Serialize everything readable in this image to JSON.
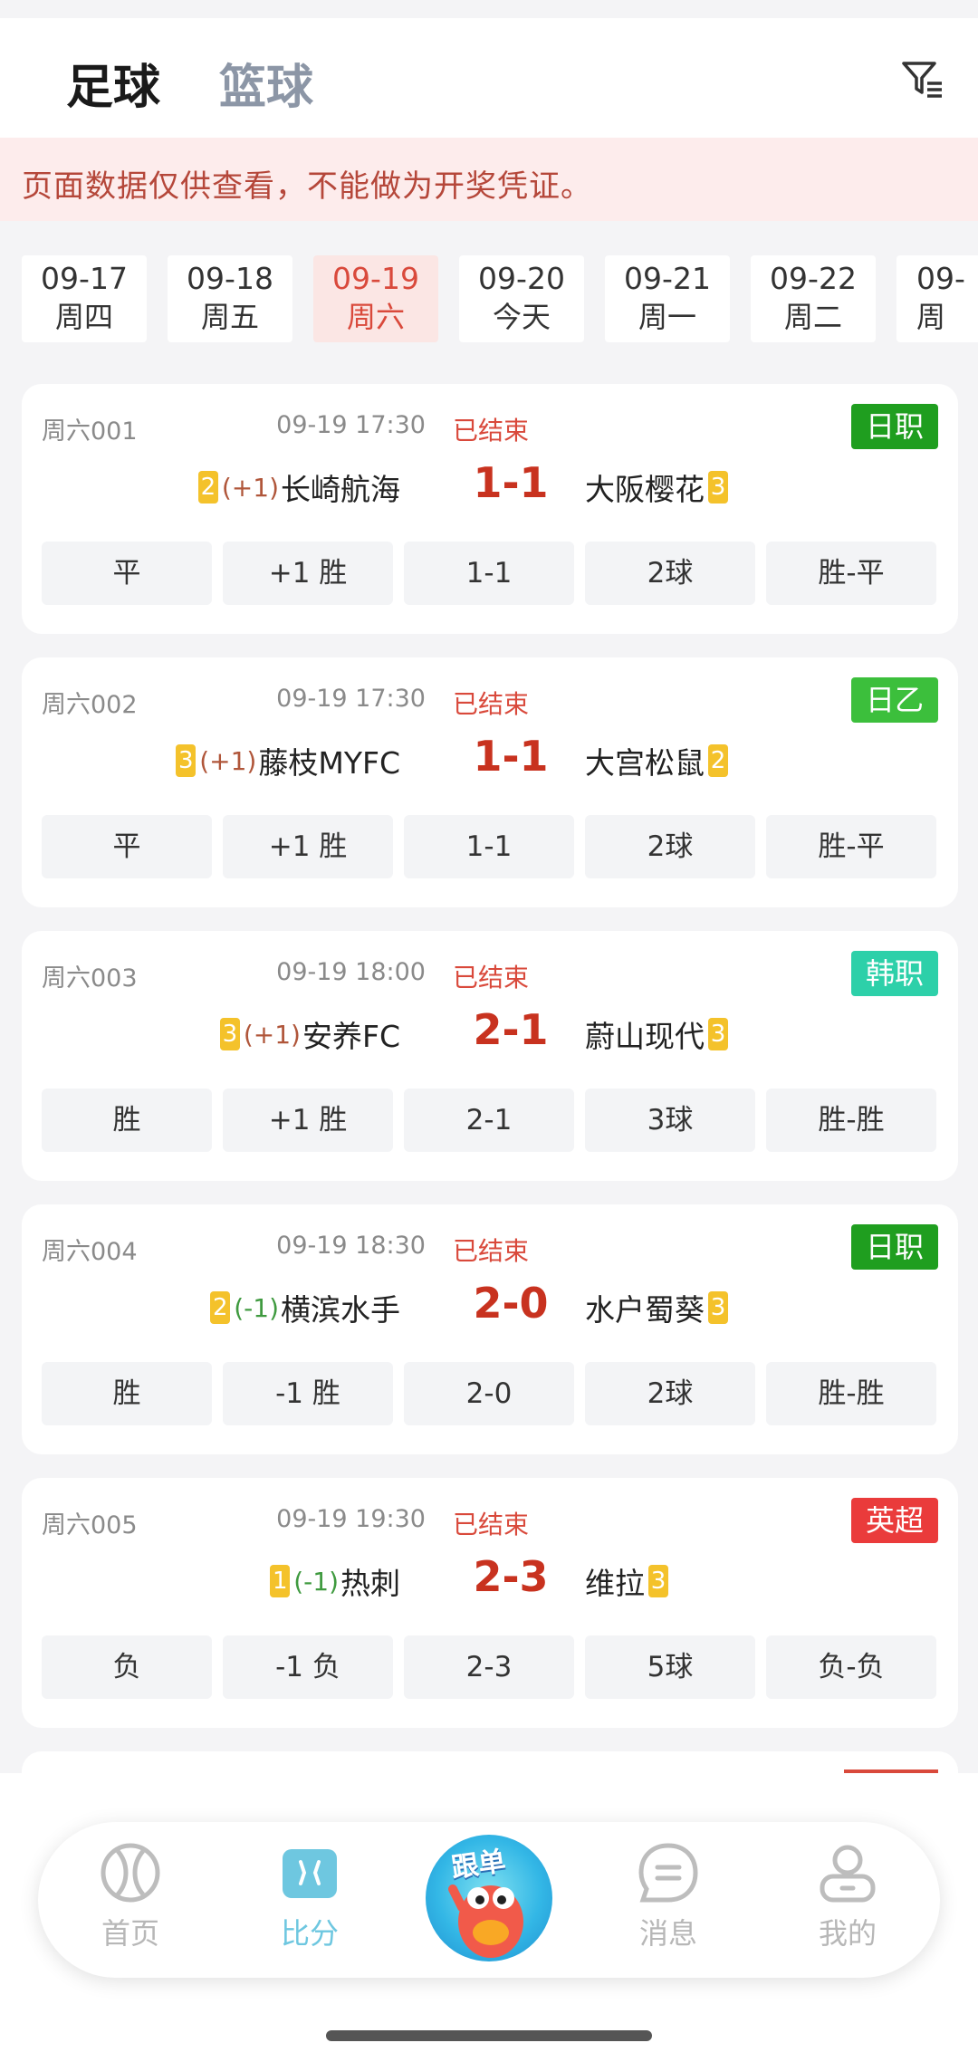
{
  "header": {
    "tab_football": "足球",
    "tab_basketball": "篮球",
    "filter_icon": "filter-icon"
  },
  "notice": "页面数据仅供查看，不能做为开奖凭证。",
  "dates": [
    {
      "date": "09-17",
      "weekday": "周四",
      "active": false
    },
    {
      "date": "09-18",
      "weekday": "周五",
      "active": false
    },
    {
      "date": "09-19",
      "weekday": "周六",
      "active": true
    },
    {
      "date": "09-20",
      "weekday": "今天",
      "active": false
    },
    {
      "date": "09-21",
      "weekday": "周一",
      "active": false
    },
    {
      "date": "09-22",
      "weekday": "周二",
      "active": false
    },
    {
      "date": "09-",
      "weekday": "周",
      "active": false
    }
  ],
  "matches": [
    {
      "code": "周六001",
      "time": "09-19 17:30",
      "status": "已结束",
      "league": "日职",
      "league_color": "#1f9e1f",
      "home_rank": "2",
      "handicap": "(+1)",
      "home": "长崎航海",
      "score": "1-1",
      "away": "大阪樱花",
      "away_rank": "3",
      "results": [
        "平",
        "+1 胜",
        "1-1",
        "2球",
        "胜-平"
      ]
    },
    {
      "code": "周六002",
      "time": "09-19 17:30",
      "status": "已结束",
      "league": "日乙",
      "league_color": "#3cbf3c",
      "home_rank": "3",
      "handicap": "(+1)",
      "home": "藤枝MYFC",
      "score": "1-1",
      "away": "大宫松鼠",
      "away_rank": "2",
      "results": [
        "平",
        "+1 胜",
        "1-1",
        "2球",
        "胜-平"
      ]
    },
    {
      "code": "周六003",
      "time": "09-19 18:00",
      "status": "已结束",
      "league": "韩职",
      "league_color": "#2dd0a9",
      "home_rank": "3",
      "handicap": "(+1)",
      "home": "安养FC",
      "score": "2-1",
      "away": "蔚山现代",
      "away_rank": "3",
      "results": [
        "胜",
        "+1 胜",
        "2-1",
        "3球",
        "胜-胜"
      ]
    },
    {
      "code": "周六004",
      "time": "09-19 18:30",
      "status": "已结束",
      "league": "日职",
      "league_color": "#1f9e1f",
      "home_rank": "2",
      "handicap": "(-1)",
      "home": "横滨水手",
      "score": "2-0",
      "away": "水户蜀葵",
      "away_rank": "3",
      "results": [
        "胜",
        "-1 胜",
        "2-0",
        "2球",
        "胜-胜"
      ]
    },
    {
      "code": "周六005",
      "time": "09-19 19:30",
      "status": "已结束",
      "league": "英超",
      "league_color": "#ea3b3b",
      "home_rank": "1",
      "handicap": "(-1)",
      "home": "热刺",
      "score": "2-3",
      "away": "维拉",
      "away_rank": "3",
      "results": [
        "负",
        "-1 负",
        "2-3",
        "5球",
        "负-负"
      ]
    }
  ],
  "nav": {
    "home": "首页",
    "score": "比分",
    "follow": "跟单",
    "messages": "消息",
    "mine": "我的"
  }
}
